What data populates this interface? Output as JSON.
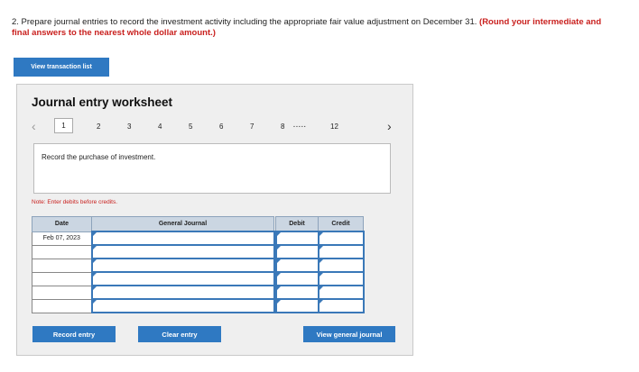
{
  "question": {
    "text": "2. Prepare journal entries to record the investment activity including the appropriate fair value adjustment on December 31.",
    "red_text": "(Round your intermediate and final answers to the nearest whole dollar amount.)"
  },
  "buttons": {
    "view_transaction_list": "View transaction list",
    "record_entry": "Record entry",
    "clear_entry": "Clear entry",
    "view_general_journal": "View general journal"
  },
  "worksheet": {
    "title": "Journal entry worksheet",
    "pages": [
      "1",
      "2",
      "3",
      "4",
      "5",
      "6",
      "7",
      "8",
      "12"
    ],
    "active_page": "1",
    "ellipsis": ".....",
    "instruction": "Record the purchase of investment.",
    "note": "Note: Enter debits before credits."
  },
  "table": {
    "headers": {
      "date": "Date",
      "account": "General Journal",
      "debit": "Debit",
      "credit": "Credit"
    },
    "rows": [
      {
        "date": "Feb 07, 2023"
      },
      {
        "date": ""
      },
      {
        "date": ""
      },
      {
        "date": ""
      },
      {
        "date": ""
      },
      {
        "date": ""
      }
    ]
  },
  "icons": {
    "prev": "chevron-left-icon",
    "next": "chevron-right-icon"
  },
  "colors": {
    "button": "#2f79c2",
    "red": "#c9201e",
    "header": "#cbd6e2",
    "input_border": "#3a78b8"
  }
}
